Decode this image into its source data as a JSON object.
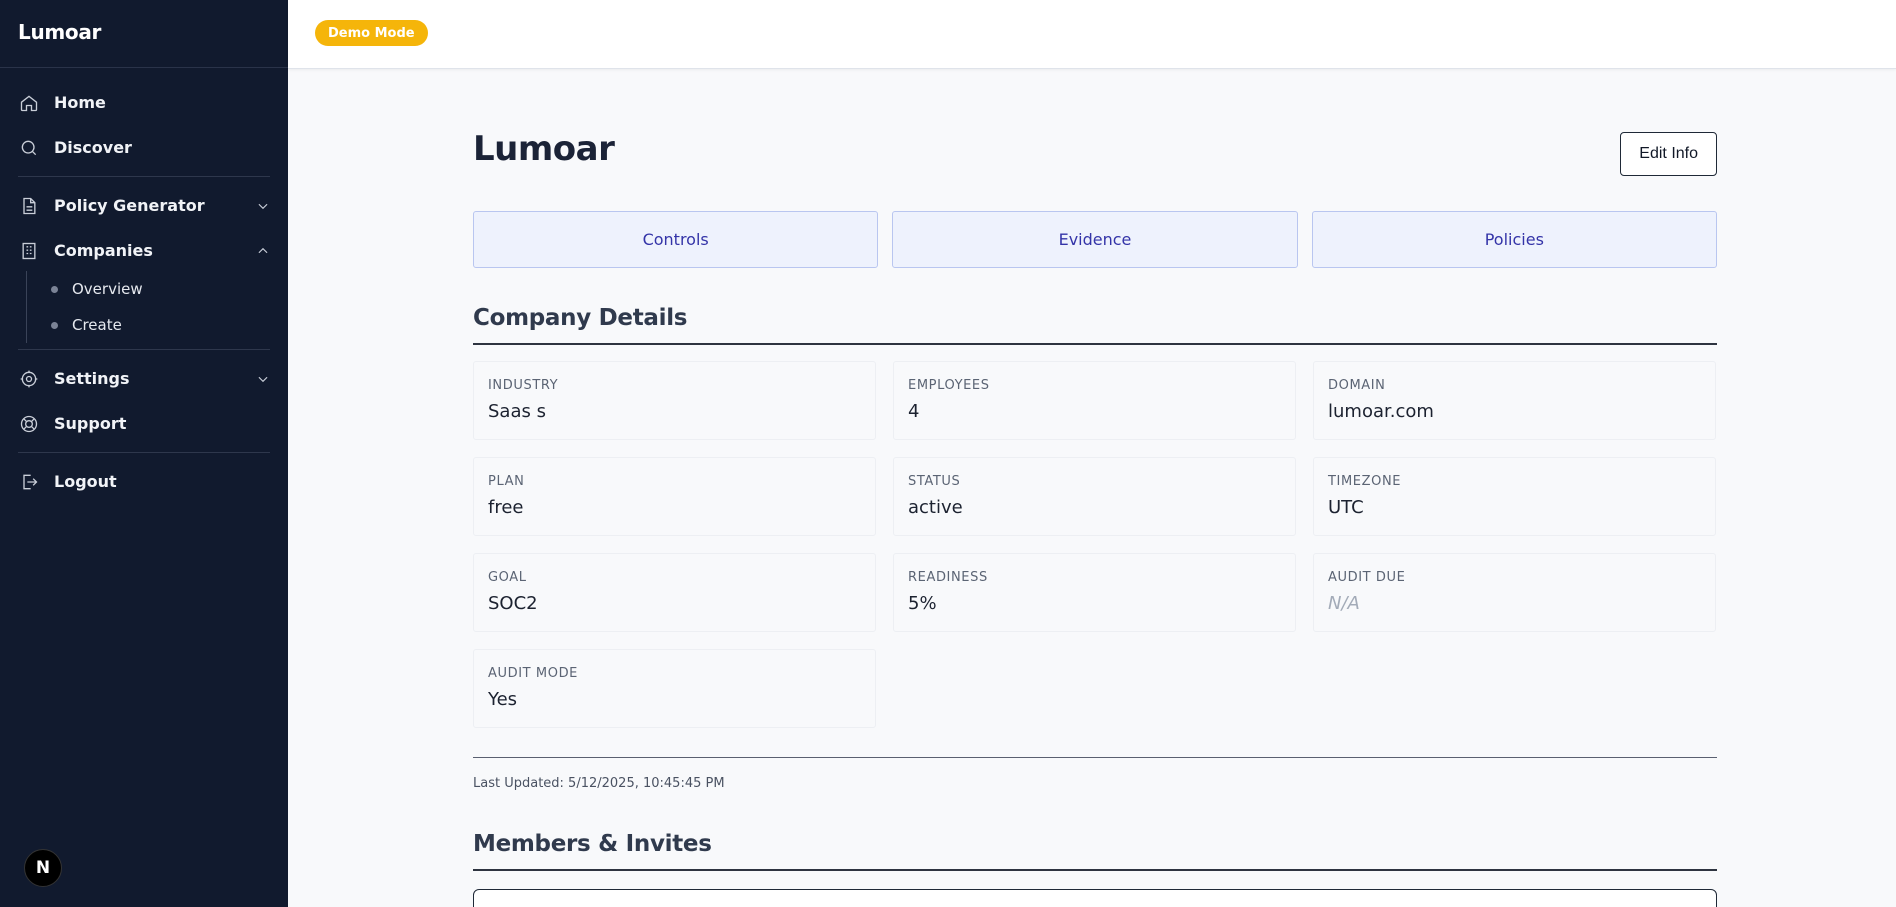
{
  "sidebar": {
    "brand": "Lumoar",
    "items": {
      "home": "Home",
      "discover": "Discover",
      "policy_generator": "Policy Generator",
      "companies": "Companies",
      "overview": "Overview",
      "create": "Create",
      "settings": "Settings",
      "support": "Support",
      "logout": "Logout"
    },
    "next_badge": "N"
  },
  "topbar": {
    "demo_badge": "Demo Mode",
    "demo_color": "#f5b50a"
  },
  "main": {
    "title": "Lumoar",
    "edit_button": "Edit Info",
    "tabs": [
      "Controls",
      "Evidence",
      "Policies"
    ],
    "details_title": "Company Details",
    "fields": [
      {
        "label": "INDUSTRY",
        "value": "Saas s"
      },
      {
        "label": "EMPLOYEES",
        "value": "4"
      },
      {
        "label": "DOMAIN",
        "value": "lumoar.com"
      },
      {
        "label": "PLAN",
        "value": "free"
      },
      {
        "label": "STATUS",
        "value": "active"
      },
      {
        "label": "TIMEZONE",
        "value": "UTC"
      },
      {
        "label": "GOAL",
        "value": "SOC2"
      },
      {
        "label": "READINESS",
        "value": "5%"
      },
      {
        "label": "AUDIT DUE",
        "value": "N/A"
      },
      {
        "label": "AUDIT MODE",
        "value": "Yes"
      }
    ],
    "last_updated": "Last Updated: 5/12/2025, 10:45:45 PM",
    "members_title": "Members & Invites"
  },
  "colors": {
    "sidebar_bg": "#111a2e",
    "tab_bg": "#eef2fd",
    "tab_text": "#3434a8"
  }
}
